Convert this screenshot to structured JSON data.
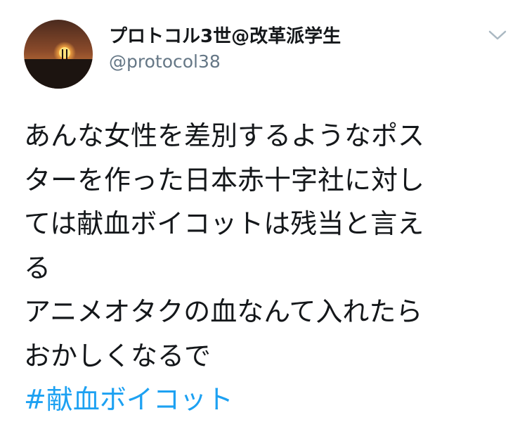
{
  "tweet": {
    "display_name": "プロトコル3世@改革派学生",
    "handle": "@protocol38",
    "lines": [
      "あんな女性を差別するようなポス",
      "ターを作った日本赤十字社に対し",
      "ては献血ボイコットは残当と言え",
      "る",
      "アニメオタクの血なんて入れたら",
      "おかしくなるで"
    ],
    "hashtag": "#献血ボイコット"
  },
  "colors": {
    "text": "#14171a",
    "handle": "#657786",
    "link": "#1da1f2",
    "caret": "#aab8c2"
  },
  "icons": {
    "avatar": "sunset-avatar",
    "menu": "chevron-down-icon"
  }
}
